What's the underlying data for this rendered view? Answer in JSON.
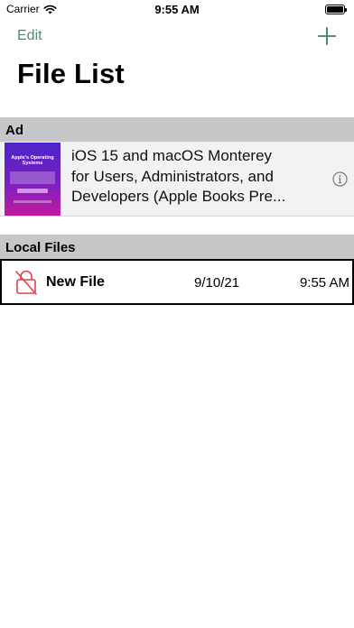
{
  "status_bar": {
    "carrier": "Carrier",
    "time": "9:55 AM",
    "battery_level": 1.0
  },
  "nav": {
    "edit_label": "Edit",
    "add_icon": "plus-icon"
  },
  "title": "File List",
  "sections": {
    "ad": {
      "header": "Ad",
      "thumbnail_title": "Apple's Operating Systems",
      "text_lines": [
        "iOS 15 and macOS Monterey",
        "for Users, Administrators, and",
        "Developers (Apple Books Pre..."
      ],
      "info_icon": "info-circle-icon"
    },
    "local": {
      "header": "Local Files",
      "files": [
        {
          "name": "New File",
          "date": "9/10/21",
          "time": "9:55 AM",
          "icon": "lock-slash-icon"
        }
      ]
    }
  },
  "colors": {
    "accent": "#4f8a72",
    "section_bg": "#c7c7c9",
    "ad_bg": "#f2f2f5",
    "lock_icon": "#e0424a"
  }
}
